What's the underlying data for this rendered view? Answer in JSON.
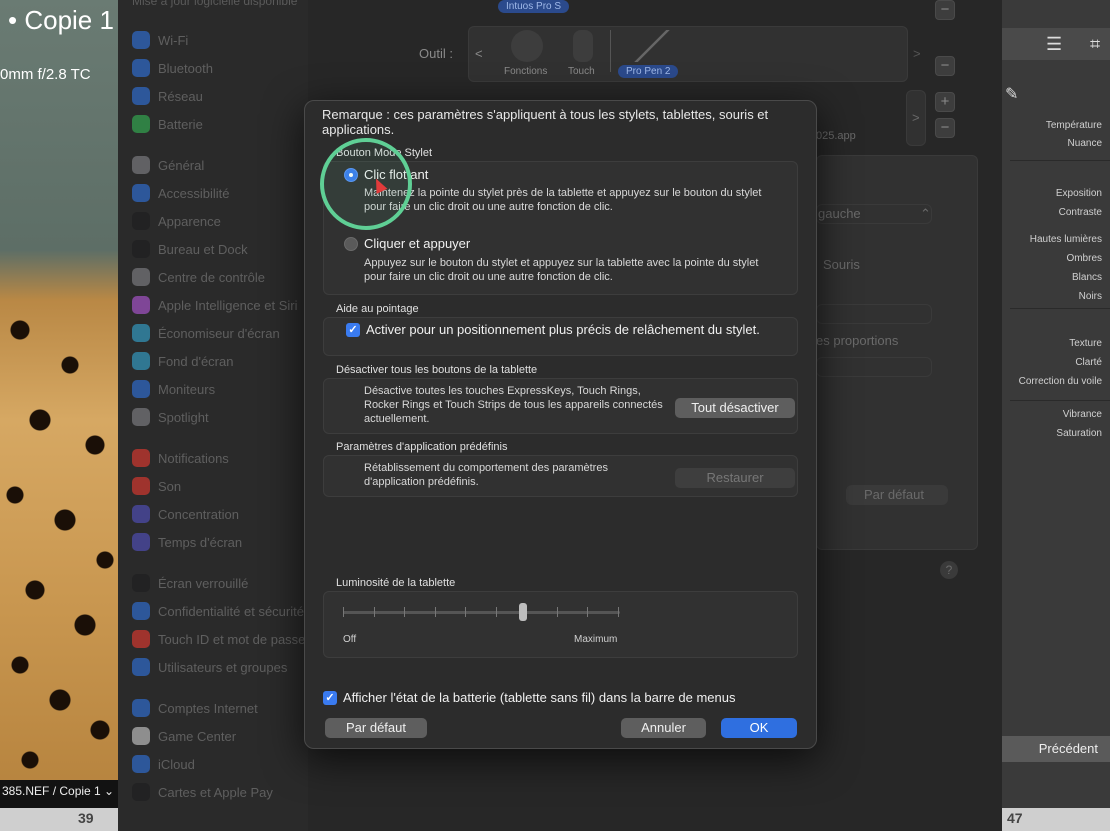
{
  "photo": {
    "title": "•  Copie 1",
    "lens": "0mm f/2.8 TC",
    "filename": "385.NEF / Copie 1 ⌄",
    "footer_left_number": "39",
    "footer_right_number": "47"
  },
  "settings_sidebar": {
    "top_hint": "Mise à jour logicielle disponible",
    "items": [
      {
        "label": "Wi-Fi",
        "color": "#2f7cf6"
      },
      {
        "label": "Bluetooth",
        "color": "#2f7cf6"
      },
      {
        "label": "Réseau",
        "color": "#2f7cf6"
      },
      {
        "label": "Batterie",
        "color": "#35c759"
      },
      {
        "label": "Général",
        "color": "#8e8e93"
      },
      {
        "label": "Accessibilité",
        "color": "#2f7cf6"
      },
      {
        "label": "Apparence",
        "color": "#1c1c1e"
      },
      {
        "label": "Bureau et Dock",
        "color": "#1c1c1e"
      },
      {
        "label": "Centre de contrôle",
        "color": "#8e8e93"
      },
      {
        "label": "Apple Intelligence et Siri",
        "color": "#c45cf0"
      },
      {
        "label": "Économiseur d'écran",
        "color": "#35b6e8"
      },
      {
        "label": "Fond d'écran",
        "color": "#35b6e8"
      },
      {
        "label": "Moniteurs",
        "color": "#2f7cf6"
      },
      {
        "label": "Spotlight",
        "color": "#8e8e93"
      },
      {
        "label": "Notifications",
        "color": "#ff3b30"
      },
      {
        "label": "Son",
        "color": "#ff3b30"
      },
      {
        "label": "Concentration",
        "color": "#5856d6"
      },
      {
        "label": "Temps d'écran",
        "color": "#5856d6"
      },
      {
        "label": "Écran verrouillé",
        "color": "#1c1c1e"
      },
      {
        "label": "Confidentialité et sécurité",
        "color": "#2f7cf6"
      },
      {
        "label": "Touch ID et mot de passe",
        "color": "#ff3b30"
      },
      {
        "label": "Utilisateurs et groupes",
        "color": "#2f7cf6"
      },
      {
        "label": "Comptes Internet",
        "color": "#2f7cf6"
      },
      {
        "label": "Game Center",
        "color": "#e0e0e0"
      },
      {
        "label": "iCloud",
        "color": "#2f7cf6"
      },
      {
        "label": "Cartes et Apple Pay",
        "color": "#1c1c1e"
      }
    ]
  },
  "settings_main": {
    "device_pill": "Intuos Pro S",
    "tool_label": "Outil :",
    "tools": [
      "Fonctions",
      "Touch",
      "Pro Pen 2"
    ],
    "app_suffix": "025.app",
    "dropdown_gauche": "gauche",
    "souris": "Souris",
    "proportions": "es proportions",
    "par_defaut": "Par défaut",
    "help": "?"
  },
  "lightroom": {
    "labels": [
      "Température",
      "Nuance",
      "Exposition",
      "Contraste",
      "Hautes lumières",
      "Ombres",
      "Blancs",
      "Noirs",
      "Texture",
      "Clarté",
      "Correction du voile",
      "Vibrance",
      "Saturation"
    ],
    "previous_button": "Précédent"
  },
  "dialog": {
    "note": "Remarque : ces paramètres s'appliquent à tous les stylets, tablettes, souris et applications.",
    "stylus_mode": {
      "title": "Bouton Mode Stylet",
      "option1_title": "Clic flottant",
      "option1_desc": "Maintenez la pointe du stylet près de la tablette et appuyez sur le bouton du stylet pour faire un clic droit ou une autre fonction de clic.",
      "option1_selected": true,
      "option2_title": "Cliquer et appuyer",
      "option2_desc": "Appuyez sur le bouton du stylet et appuyez sur la tablette avec la pointe du stylet pour faire un clic droit ou une autre fonction de clic."
    },
    "pointing": {
      "title": "Aide au pointage",
      "checkbox_label": "Activer pour un positionnement plus précis de relâchement du stylet.",
      "checked": true
    },
    "disable_buttons": {
      "title": "Désactiver tous les boutons de la tablette",
      "desc": "Désactive toutes les touches ExpressKeys, Touch Rings, Rocker Rings et Touch Strips de tous les appareils connectés actuellement.",
      "button": "Tout désactiver"
    },
    "app_presets": {
      "title": "Paramètres d'application prédéfinis",
      "desc": "Rétablissement du comportement des paramètres d'application prédéfinis.",
      "button": "Restaurer"
    },
    "brightness": {
      "title": "Luminosité de la tablette",
      "min_label": "Off",
      "max_label": "Maximum",
      "value_fraction": 0.65
    },
    "battery_checkbox": "Afficher l'état de la batterie (tablette sans fil) dans la barre de menus",
    "battery_checked": true,
    "buttons": {
      "default": "Par défaut",
      "cancel": "Annuler",
      "ok": "OK"
    }
  }
}
